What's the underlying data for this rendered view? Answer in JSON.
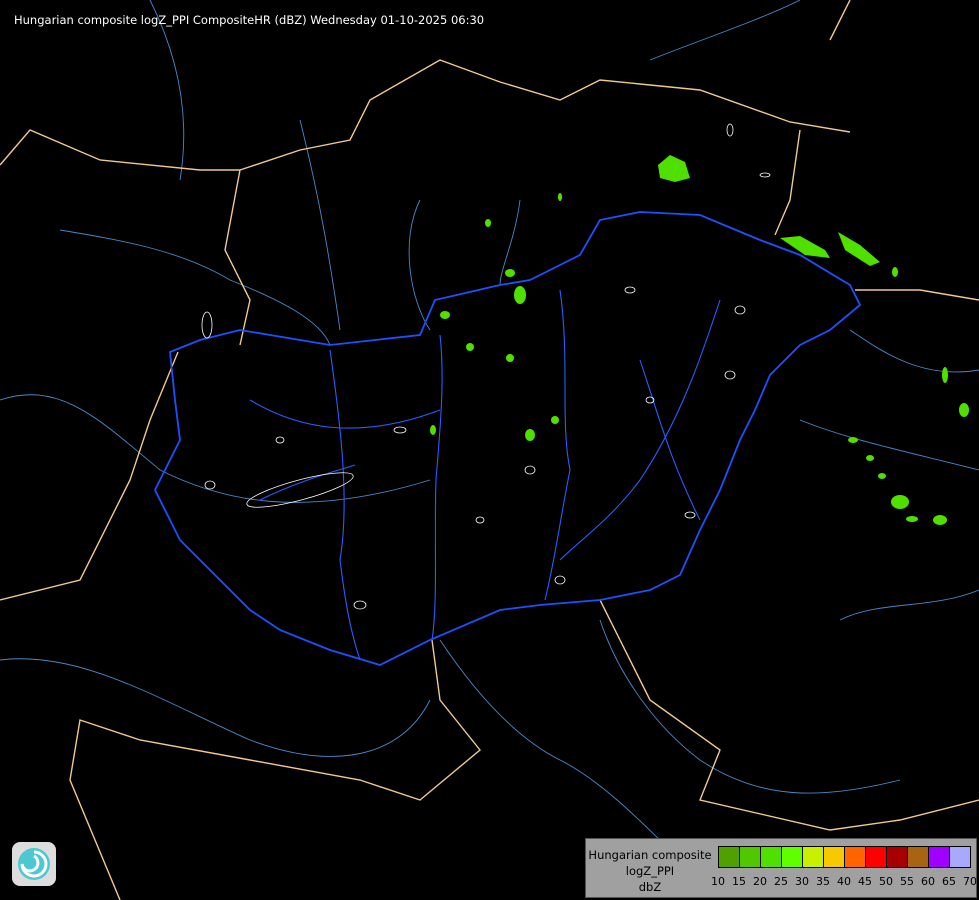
{
  "title": "Hungarian composite logZ_PPI CompositeHR (dBZ) Wednesday 01-10-2025 06:30",
  "legend": {
    "lines": [
      "Hungarian composite",
      "logZ_PPI",
      "dbZ"
    ],
    "ticks": [
      "10",
      "15",
      "20",
      "25",
      "30",
      "35",
      "40",
      "45",
      "50",
      "55",
      "60",
      "65",
      "70"
    ],
    "colors": [
      "#50a000",
      "#50c800",
      "#50e000",
      "#60ff00",
      "#c8f000",
      "#f8c800",
      "#ff6400",
      "#ff0000",
      "#a80000",
      "#a86410",
      "#a000ff",
      "#a8a8ff"
    ]
  },
  "map_colors": {
    "hungary_border": "#1e50ff",
    "country_borders": "#f0c890",
    "rivers": "#5090d0",
    "radar_echo": "#50e000",
    "contours": "#ffffff"
  },
  "logo": {
    "icon": "swirl-logo-icon"
  }
}
